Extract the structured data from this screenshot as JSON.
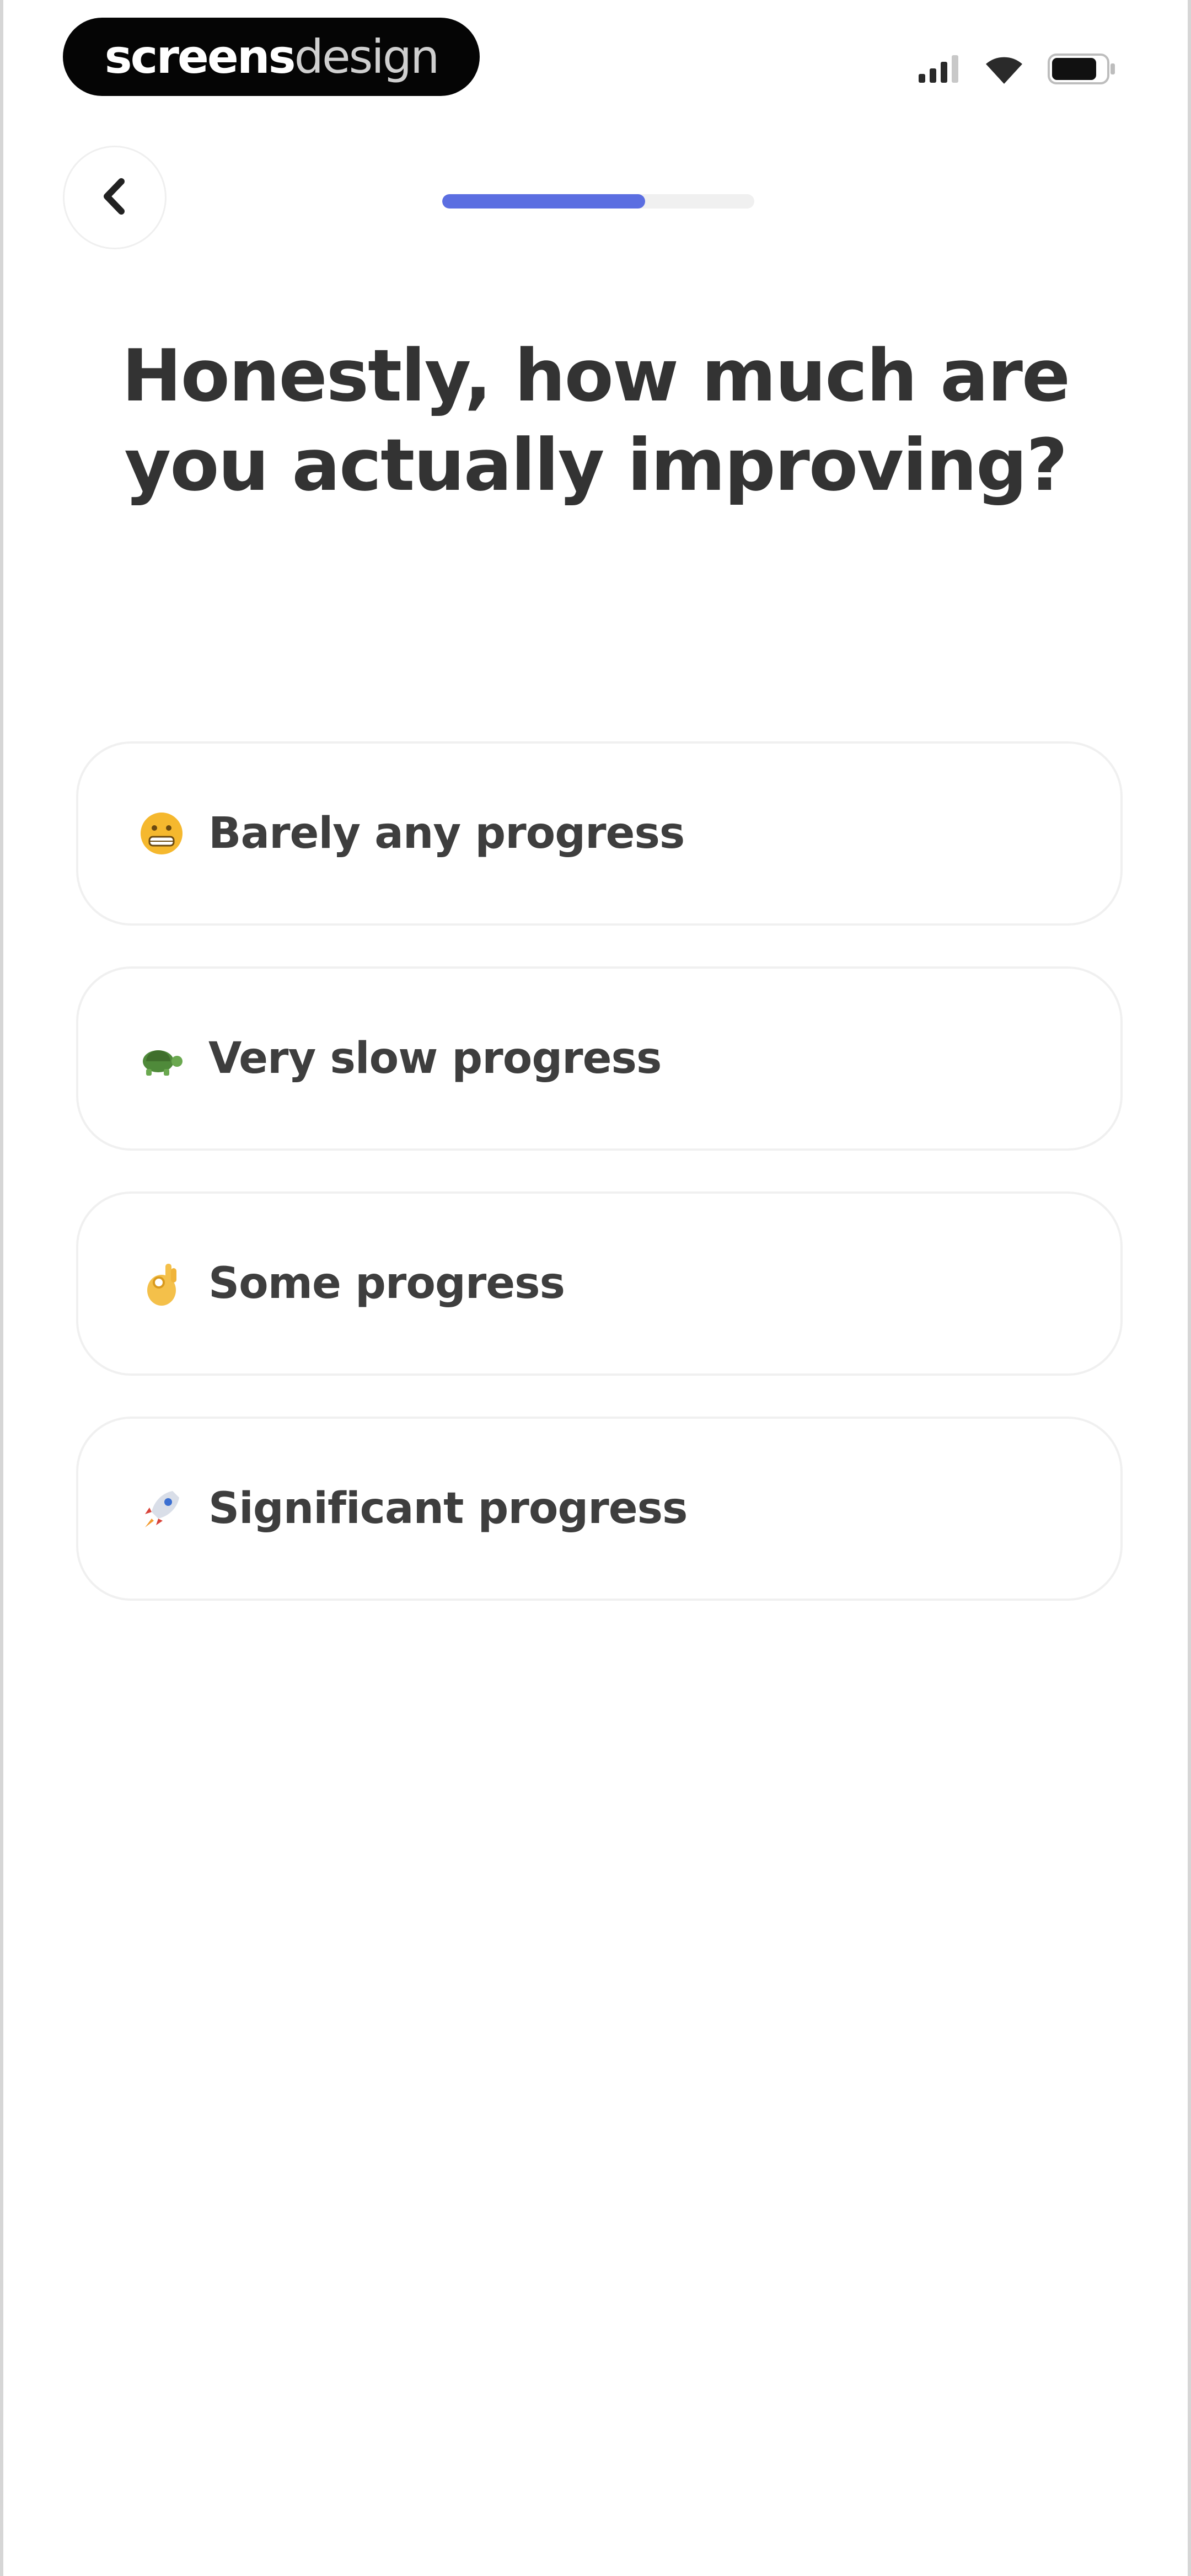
{
  "status_bar": {
    "brand_part1": "screens",
    "brand_part2": "design",
    "icons": [
      "cellular-signal-icon",
      "wifi-icon",
      "battery-icon"
    ]
  },
  "header": {
    "back_icon": "chevron-left-icon",
    "progress_fraction": 0.65,
    "accent_color": "#5b6ee1"
  },
  "question": {
    "line1": "Honestly, how much are",
    "line2": "you actually improving?"
  },
  "options": [
    {
      "emoji": "grimacing-face-icon",
      "label": "Barely any progress"
    },
    {
      "emoji": "turtle-icon",
      "label": "Very slow progress"
    },
    {
      "emoji": "ok-hand-icon",
      "label": "Some progress"
    },
    {
      "emoji": "rocket-icon",
      "label": "Significant progress"
    }
  ]
}
